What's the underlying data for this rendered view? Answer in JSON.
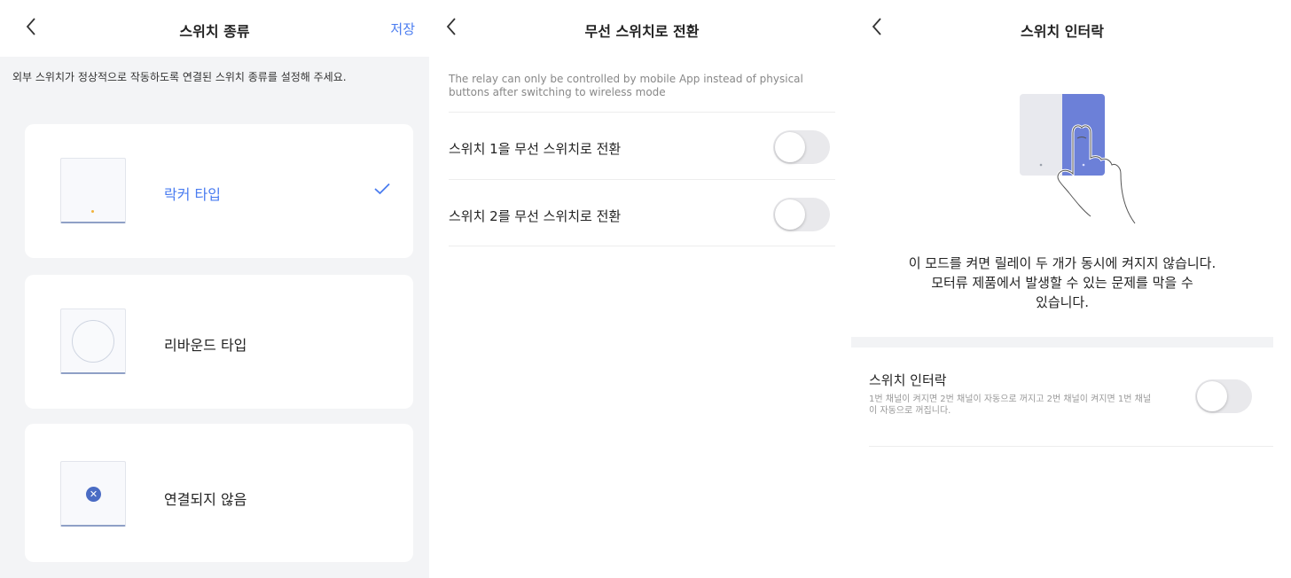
{
  "screen1": {
    "nav": {
      "back_icon": "chevron-left-icon",
      "title": "스위치 종류",
      "save_label": "저장"
    },
    "description": "외부 스위치가 정상적으로 작동하도록 연결된 스위치 종류를 설정해 주세요.",
    "options": [
      {
        "label": "락커 타입",
        "selected": true,
        "icon": "rocker-switch-icon"
      },
      {
        "label": "리바운드 타입",
        "selected": false,
        "icon": "rebound-switch-icon"
      },
      {
        "label": "연결되지 않음",
        "selected": false,
        "icon": "not-connected-icon"
      }
    ],
    "selected_icon": "checkmark-icon",
    "accent_color": "#4a7cf0"
  },
  "screen2": {
    "nav": {
      "back_icon": "chevron-left-icon",
      "title": "무선 스위치로 전환"
    },
    "info": "The relay can only be controlled by mobile App instead of physical buttons after switching to wireless mode",
    "rows": [
      {
        "label": "스위치 1을 무선 스위치로 전환",
        "enabled": false
      },
      {
        "label": "스위치 2를 무선 스위치로 전환",
        "enabled": false
      }
    ]
  },
  "screen3": {
    "nav": {
      "back_icon": "chevron-left-icon",
      "title": "스위치 인터락"
    },
    "illustration_icon": "hand-pressing-switch-icon",
    "message_lines": [
      "이 모드를 켜면  릴레이 두 개가 동시에 켜지지 않습니다.",
      "모터류 제품에서 발생할 수 있는 문제를 막을 수",
      "있습니다."
    ],
    "setting": {
      "title": "스위치 인터락",
      "subtitle": "1번 채널이 켜지면 2번 채널이 자동으로 꺼지고 2번 채널이 켜지면 1번 채널이 자동으로 꺼집니다.",
      "enabled": false
    }
  }
}
